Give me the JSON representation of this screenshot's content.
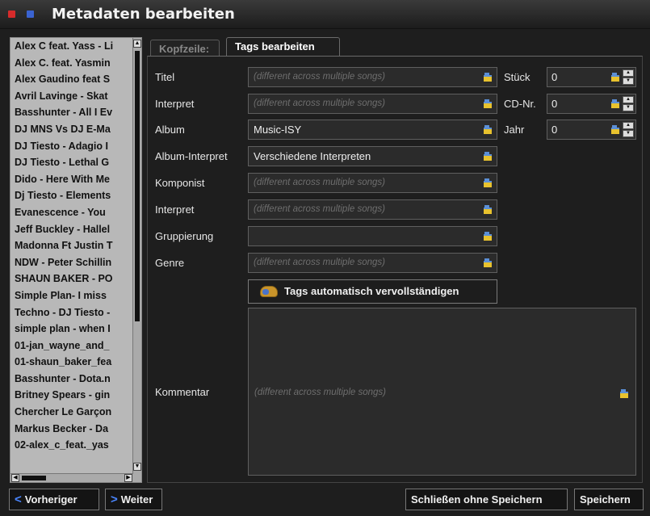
{
  "window": {
    "title": "Metadaten bearbeiten"
  },
  "songs": [
    "Alex C feat. Yass - Li",
    "Alex C. feat. Yasmin",
    "Alex Gaudino feat S",
    "Avril Lavinge - Skat",
    "Basshunter - All I Ev",
    "DJ MNS Vs DJ E-Ma",
    "DJ Tiesto - Adagio I",
    "DJ Tiesto - Lethal G",
    "Dido - Here With Me",
    "Dj Tiesto - Elements",
    "Evanescence - You",
    "Jeff Buckley - Hallel",
    "Madonna Ft Justin T",
    "NDW - Peter Schillin",
    "SHAUN BAKER - PO",
    "Simple Plan- I miss",
    "Techno - DJ Tiesto -",
    "simple plan - when I",
    "01-jan_wayne_and_",
    "01-shaun_baker_fea",
    "Basshunter - Dota.n",
    "Britney Spears - gin",
    "Chercher Le Garçon",
    "Markus Becker - Da",
    "02-alex_c_feat._yas"
  ],
  "tabs": {
    "copy": "Kopfzeile:",
    "tags": "Tags bearbeiten"
  },
  "fields": {
    "placeholder": "(different across multiple songs)",
    "title_label": "Titel",
    "interpret_label": "Interpret",
    "album_label": "Album",
    "album_value": "Music-ISY",
    "album_interpret_label": "Album-Interpret",
    "album_interpret_value": "Verschiedene Interpreten",
    "composer_label": "Komponist",
    "interpret2_label": "Interpret",
    "grouping_label": "Gruppierung",
    "genre_label": "Genre",
    "comment_label": "Kommentar",
    "track_label": "Stück",
    "track_value": "0",
    "cd_label": "CD-Nr.",
    "cd_value": "0",
    "year_label": "Jahr",
    "year_value": "0"
  },
  "buttons": {
    "autocomplete": "Tags automatisch vervollständigen",
    "previous": "Vorheriger",
    "next": "Weiter",
    "close_no_save": "Schließen ohne Speichern",
    "save": "Speichern"
  },
  "icons": {
    "folder": "folder-icon",
    "brain": "brain-icon",
    "close": "close-icon",
    "minimize": "minimize-icon"
  },
  "colors": {
    "accent": "#4a86ff",
    "close": "#d62b2b",
    "minimize": "#3a63d1"
  }
}
